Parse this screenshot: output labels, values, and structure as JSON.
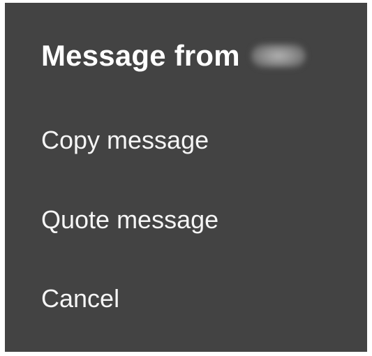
{
  "dialog": {
    "title": "Message from",
    "sender_redacted": true
  },
  "menu": {
    "items": [
      {
        "label": "Copy message"
      },
      {
        "label": "Quote message"
      },
      {
        "label": "Cancel"
      }
    ]
  },
  "colors": {
    "dialog_background": "#434343",
    "text": "#ffffff"
  }
}
